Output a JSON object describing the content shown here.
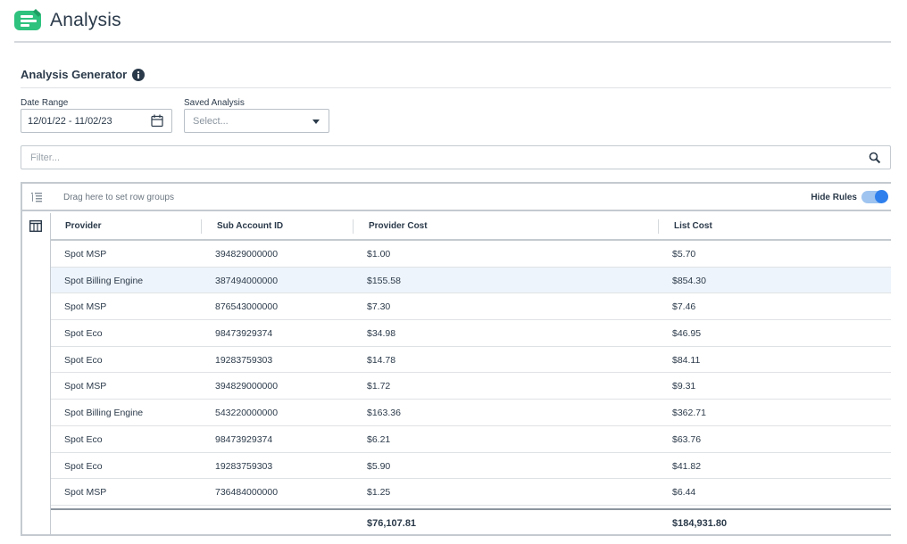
{
  "header": {
    "title": "Analysis",
    "logo_icon": "analysis-logo-icon"
  },
  "generator": {
    "title": "Analysis Generator",
    "info_icon": "info-icon"
  },
  "date_range": {
    "label": "Date Range",
    "value": "12/01/22 - 11/02/23",
    "icon": "calendar-icon"
  },
  "saved_analysis": {
    "label": "Saved Analysis",
    "placeholder": "Select..."
  },
  "filter": {
    "placeholder": "Filter...",
    "icon": "search-icon"
  },
  "grid": {
    "group_hint": "Drag here to set row groups",
    "hide_rules_label": "Hide Rules",
    "hide_rules_on": true,
    "columns": [
      "Provider",
      "Sub Account ID",
      "Provider Cost",
      "List Cost"
    ],
    "rows": [
      {
        "provider": "Spot MSP",
        "sub_account_id": "394829000000",
        "provider_cost": "$1.00",
        "list_cost": "$5.70"
      },
      {
        "provider": "Spot Billing Engine",
        "sub_account_id": "387494000000",
        "provider_cost": "$155.58",
        "list_cost": "$854.30"
      },
      {
        "provider": "Spot MSP",
        "sub_account_id": "876543000000",
        "provider_cost": "$7.30",
        "list_cost": "$7.46"
      },
      {
        "provider": "Spot Eco",
        "sub_account_id": "98473929374",
        "provider_cost": "$34.98",
        "list_cost": "$46.95"
      },
      {
        "provider": "Spot Eco",
        "sub_account_id": "19283759303",
        "provider_cost": "$14.78",
        "list_cost": "$84.11"
      },
      {
        "provider": "Spot MSP",
        "sub_account_id": "394829000000",
        "provider_cost": "$1.72",
        "list_cost": "$9.31"
      },
      {
        "provider": "Spot Billing Engine",
        "sub_account_id": "543220000000",
        "provider_cost": "$163.36",
        "list_cost": "$362.71"
      },
      {
        "provider": "Spot Eco",
        "sub_account_id": "98473929374",
        "provider_cost": "$6.21",
        "list_cost": "$63.76"
      },
      {
        "provider": "Spot Eco",
        "sub_account_id": "19283759303",
        "provider_cost": "$5.90",
        "list_cost": "$41.82"
      },
      {
        "provider": "Spot MSP",
        "sub_account_id": "736484000000",
        "provider_cost": "$1.25",
        "list_cost": "$6.44"
      }
    ],
    "highlighted_row": 1,
    "totals": {
      "provider_cost": "$76,107.81",
      "list_cost": "$184,931.80"
    }
  },
  "colors": {
    "brand_green": "#2ec27e",
    "accent_blue": "#2f80ed",
    "row_highlight": "#eef4fb"
  }
}
